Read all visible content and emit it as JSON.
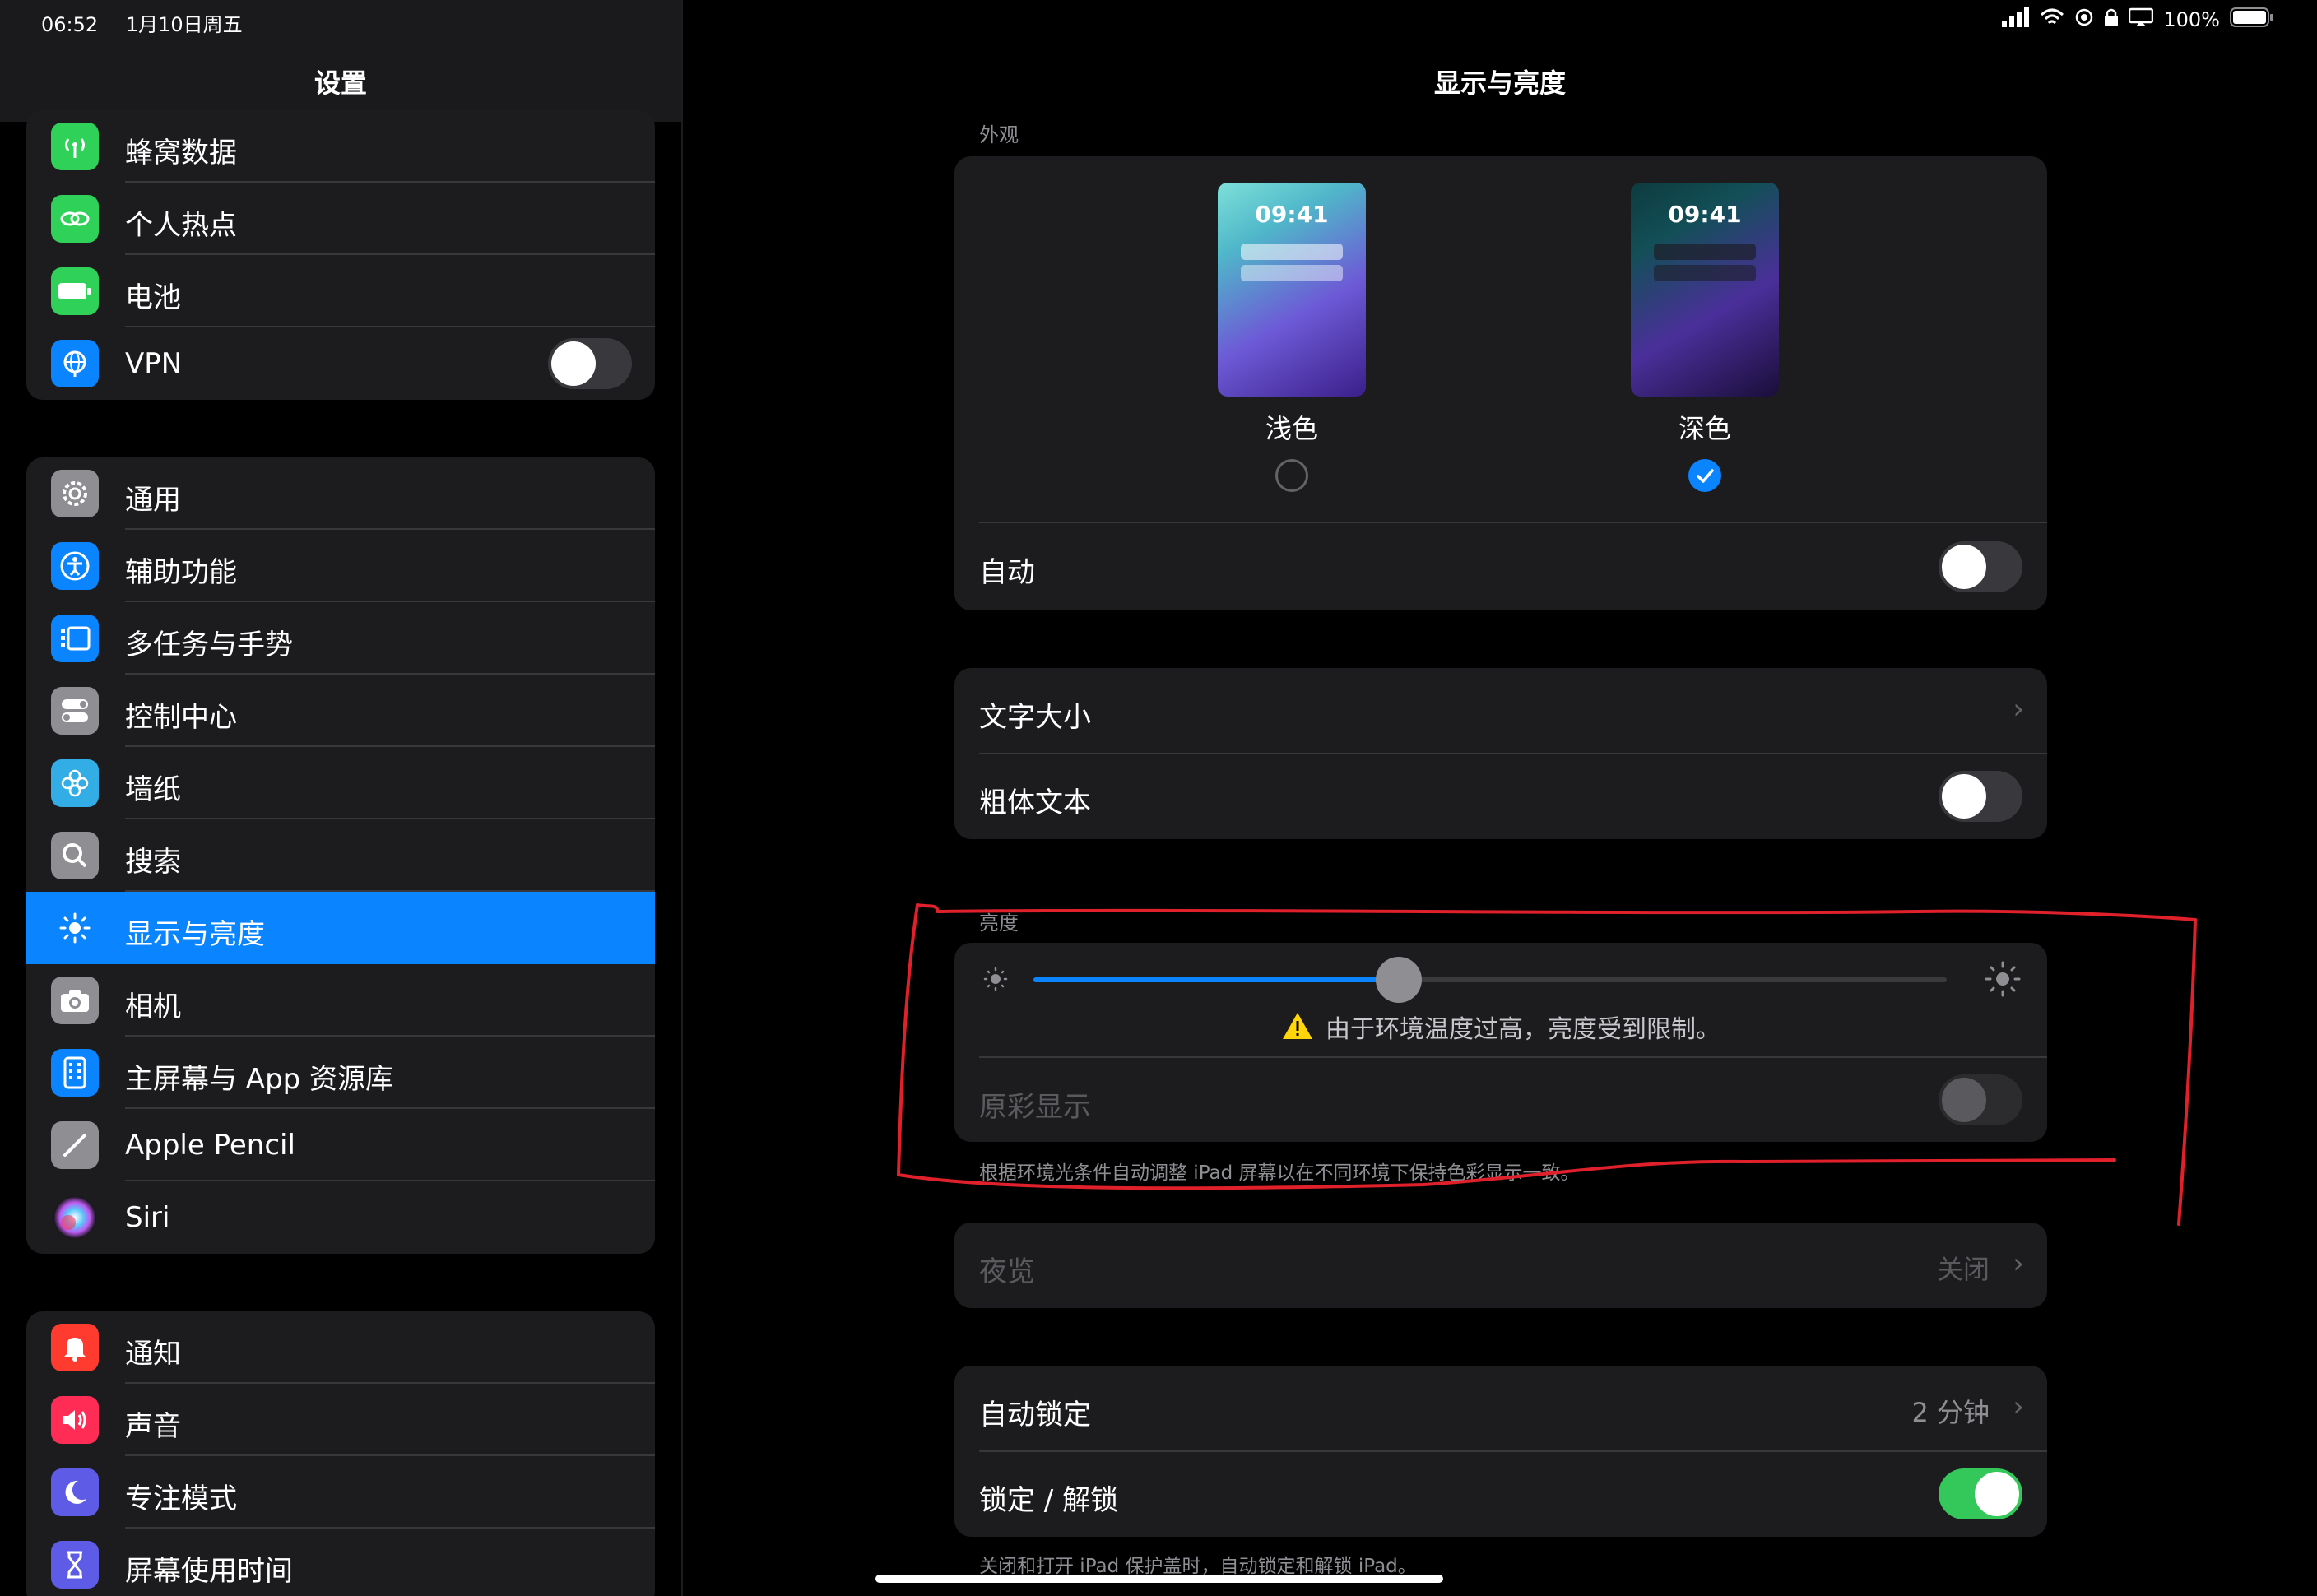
{
  "status_bar": {
    "time": "06:52",
    "date": "1月10日周五",
    "battery": "100%"
  },
  "sidebar": {
    "title": "设置",
    "groups": [
      [
        {
          "label": "蜂窝数据",
          "icon": "antenna-icon",
          "color": "#30d158"
        },
        {
          "label": "个人热点",
          "icon": "hotspot-icon",
          "color": "#30d158"
        },
        {
          "label": "电池",
          "icon": "battery-icon",
          "color": "#30d158"
        },
        {
          "label": "VPN",
          "icon": "globe-icon",
          "color": "#0a84ff",
          "toggle": false
        }
      ],
      [
        {
          "label": "通用",
          "icon": "gear-icon",
          "color": "#8e8e93"
        },
        {
          "label": "辅助功能",
          "icon": "accessibility-icon",
          "color": "#0a84ff"
        },
        {
          "label": "多任务与手势",
          "icon": "multitask-icon",
          "color": "#0a84ff"
        },
        {
          "label": "控制中心",
          "icon": "control-center-icon",
          "color": "#8e8e93"
        },
        {
          "label": "墙纸",
          "icon": "flower-icon",
          "color": "#32ade6"
        },
        {
          "label": "搜索",
          "icon": "search-icon",
          "color": "#8e8e93"
        },
        {
          "label": "显示与亮度",
          "icon": "sun-icon",
          "color": "#0a84ff",
          "selected": true
        },
        {
          "label": "相机",
          "icon": "camera-icon",
          "color": "#8e8e93"
        },
        {
          "label": "主屏幕与 App 资源库",
          "icon": "home-screen-icon",
          "color": "#0a84ff"
        },
        {
          "label": "Apple Pencil",
          "icon": "pencil-icon",
          "color": "#8e8e93"
        },
        {
          "label": "Siri",
          "icon": "siri-icon",
          "color": "#1c1c1e"
        }
      ],
      [
        {
          "label": "通知",
          "icon": "bell-icon",
          "color": "#ff3b30"
        },
        {
          "label": "声音",
          "icon": "speaker-icon",
          "color": "#ff2d55"
        },
        {
          "label": "专注模式",
          "icon": "moon-icon",
          "color": "#5e5ce6"
        },
        {
          "label": "屏幕使用时间",
          "icon": "hourglass-icon",
          "color": "#5e5ce6"
        }
      ]
    ]
  },
  "main": {
    "title": "显示与亮度",
    "appearance": {
      "section": "外观",
      "light_label": "浅色",
      "dark_label": "深色",
      "thumb_time": "09:41",
      "selected": "dark",
      "auto_label": "自动",
      "auto_on": false
    },
    "text": {
      "text_size_label": "文字大小",
      "bold_label": "粗体文本",
      "bold_on": false
    },
    "brightness": {
      "section": "亮度",
      "level": 0.4,
      "warning": "由于环境温度过高，亮度受到限制。",
      "true_tone_label": "原彩显示",
      "true_tone_on": false,
      "footnote": "根据环境光条件自动调整 iPad 屏幕以在不同环境下保持色彩显示一致。"
    },
    "night_shift": {
      "label": "夜览",
      "value": "关闭"
    },
    "lock": {
      "auto_lock_label": "自动锁定",
      "auto_lock_value": "2 分钟",
      "lock_unlock_label": "锁定 / 解锁",
      "lock_unlock_on": true,
      "footnote": "关闭和打开 iPad 保护盖时，自动锁定和解锁 iPad。"
    }
  },
  "colors": {
    "accent": "#0a84ff",
    "annotation": "#e0202a",
    "toggle_on": "#34c759"
  }
}
